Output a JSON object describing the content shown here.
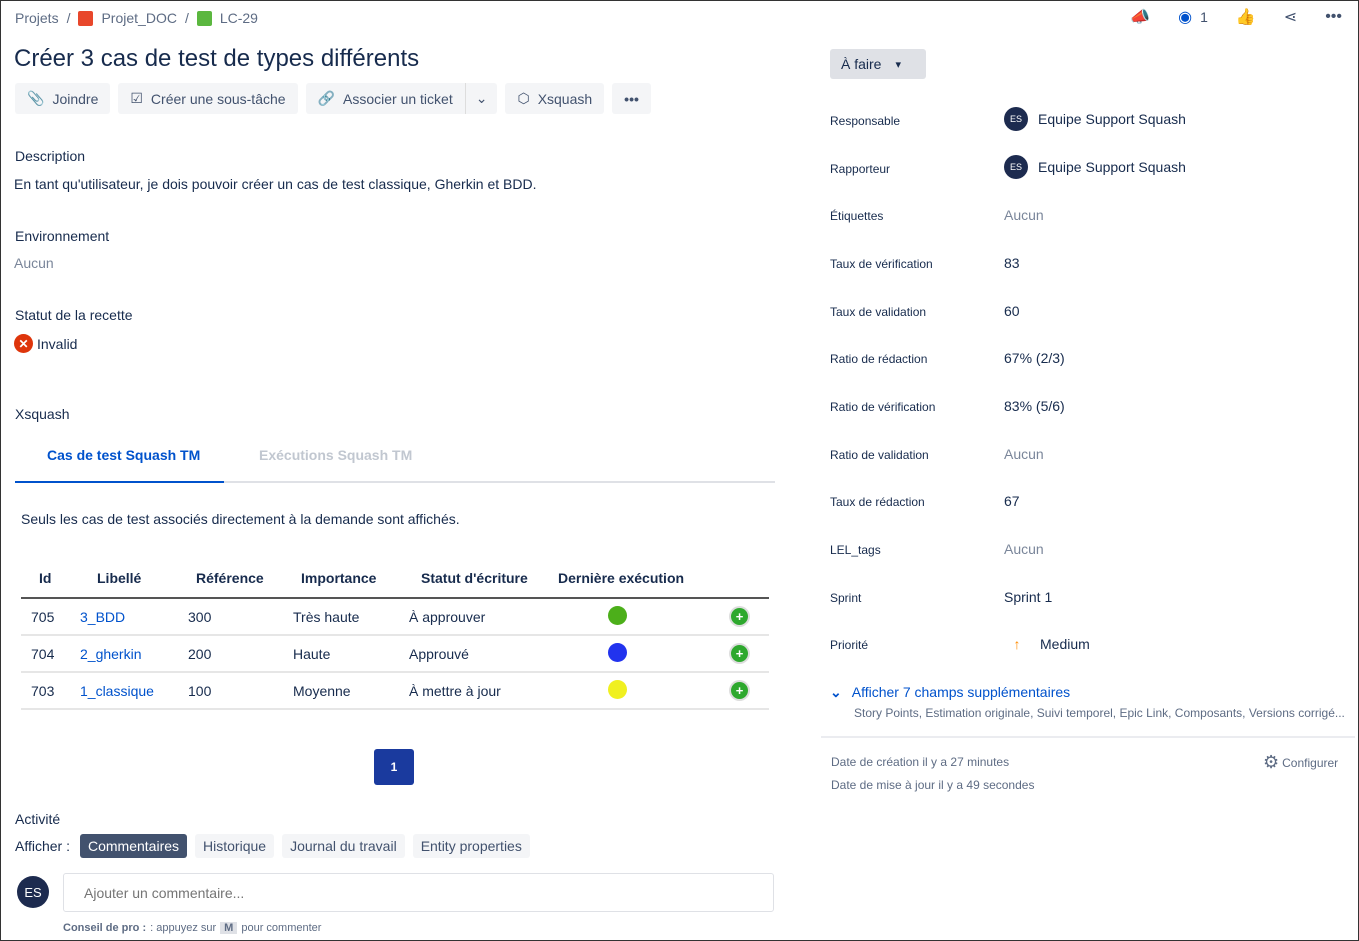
{
  "breadcrumb": {
    "root": "Projets",
    "project": "Projet_DOC",
    "issue": "LC-29"
  },
  "header": {
    "watch_count": "1"
  },
  "title": "Créer 3 cas de test de types différents",
  "toolbar": {
    "attach": "Joindre",
    "subtask": "Créer une sous-tâche",
    "link": "Associer un ticket",
    "xsquash": "Xsquash"
  },
  "description": {
    "label": "Description",
    "text": "En tant qu'utilisateur, je dois pouvoir créer un cas de test classique, Gherkin et BDD."
  },
  "environment": {
    "label": "Environnement",
    "value": "Aucun"
  },
  "recette": {
    "label": "Statut de la recette",
    "value": "Invalid"
  },
  "xsquash": {
    "label": "Xsquash",
    "tabs": [
      "Cas de test Squash TM",
      "Exécutions Squash TM"
    ],
    "note": "Seuls les cas de test associés directement à la demande sont affichés.",
    "columns": [
      "Id",
      "Libellé",
      "Référence",
      "Importance",
      "Statut d'écriture",
      "Dernière exécution"
    ],
    "rows": [
      {
        "id": "705",
        "label": "3_BDD",
        "ref": "300",
        "importance": "Très haute",
        "status": "À approuver",
        "color": "#4caf1a"
      },
      {
        "id": "704",
        "label": "2_gherkin",
        "ref": "200",
        "importance": "Haute",
        "status": "Approuvé",
        "color": "#2233ee"
      },
      {
        "id": "703",
        "label": "1_classique",
        "ref": "100",
        "importance": "Moyenne",
        "status": "À mettre à jour",
        "color": "#f0f020"
      }
    ],
    "page": "1"
  },
  "activity": {
    "label": "Activité",
    "show": "Afficher :",
    "tabs": [
      "Commentaires",
      "Historique",
      "Journal du travail",
      "Entity properties"
    ],
    "avatar": "ES",
    "placeholder": "Ajouter un commentaire...",
    "tip_bold": "Conseil de pro :",
    "tip_a": ": appuyez sur",
    "tip_key": "M",
    "tip_b": "pour commenter"
  },
  "status_button": "À faire",
  "fields": [
    {
      "label": "Responsable",
      "value": "Equipe Support Squash",
      "avatar": "ES"
    },
    {
      "label": "Rapporteur",
      "value": "Equipe Support Squash",
      "avatar": "ES"
    },
    {
      "label": "Étiquettes",
      "value": "Aucun",
      "muted": true
    },
    {
      "label": "Taux de vérification",
      "value": "83"
    },
    {
      "label": "Taux de validation",
      "value": "60"
    },
    {
      "label": "Ratio de rédaction",
      "value": "67% (2/3)"
    },
    {
      "label": "Ratio de vérification",
      "value": "83% (5/6)"
    },
    {
      "label": "Ratio de validation",
      "value": "Aucun",
      "muted": true
    },
    {
      "label": "Taux de rédaction",
      "value": "67"
    },
    {
      "label": "LEL_tags",
      "value": "Aucun",
      "muted": true
    },
    {
      "label": "Sprint",
      "value": "Sprint 1"
    },
    {
      "label": "Priorité",
      "value": "Medium",
      "priority": true
    }
  ],
  "more": {
    "label": "Afficher 7 champs supplémentaires",
    "list": "Story Points, Estimation originale, Suivi temporel, Epic Link, Composants, Versions corrigé..."
  },
  "dates": {
    "created": "Date de création il y a 27 minutes",
    "updated": "Date de mise à jour il y a 49 secondes",
    "configure": "Configurer"
  }
}
